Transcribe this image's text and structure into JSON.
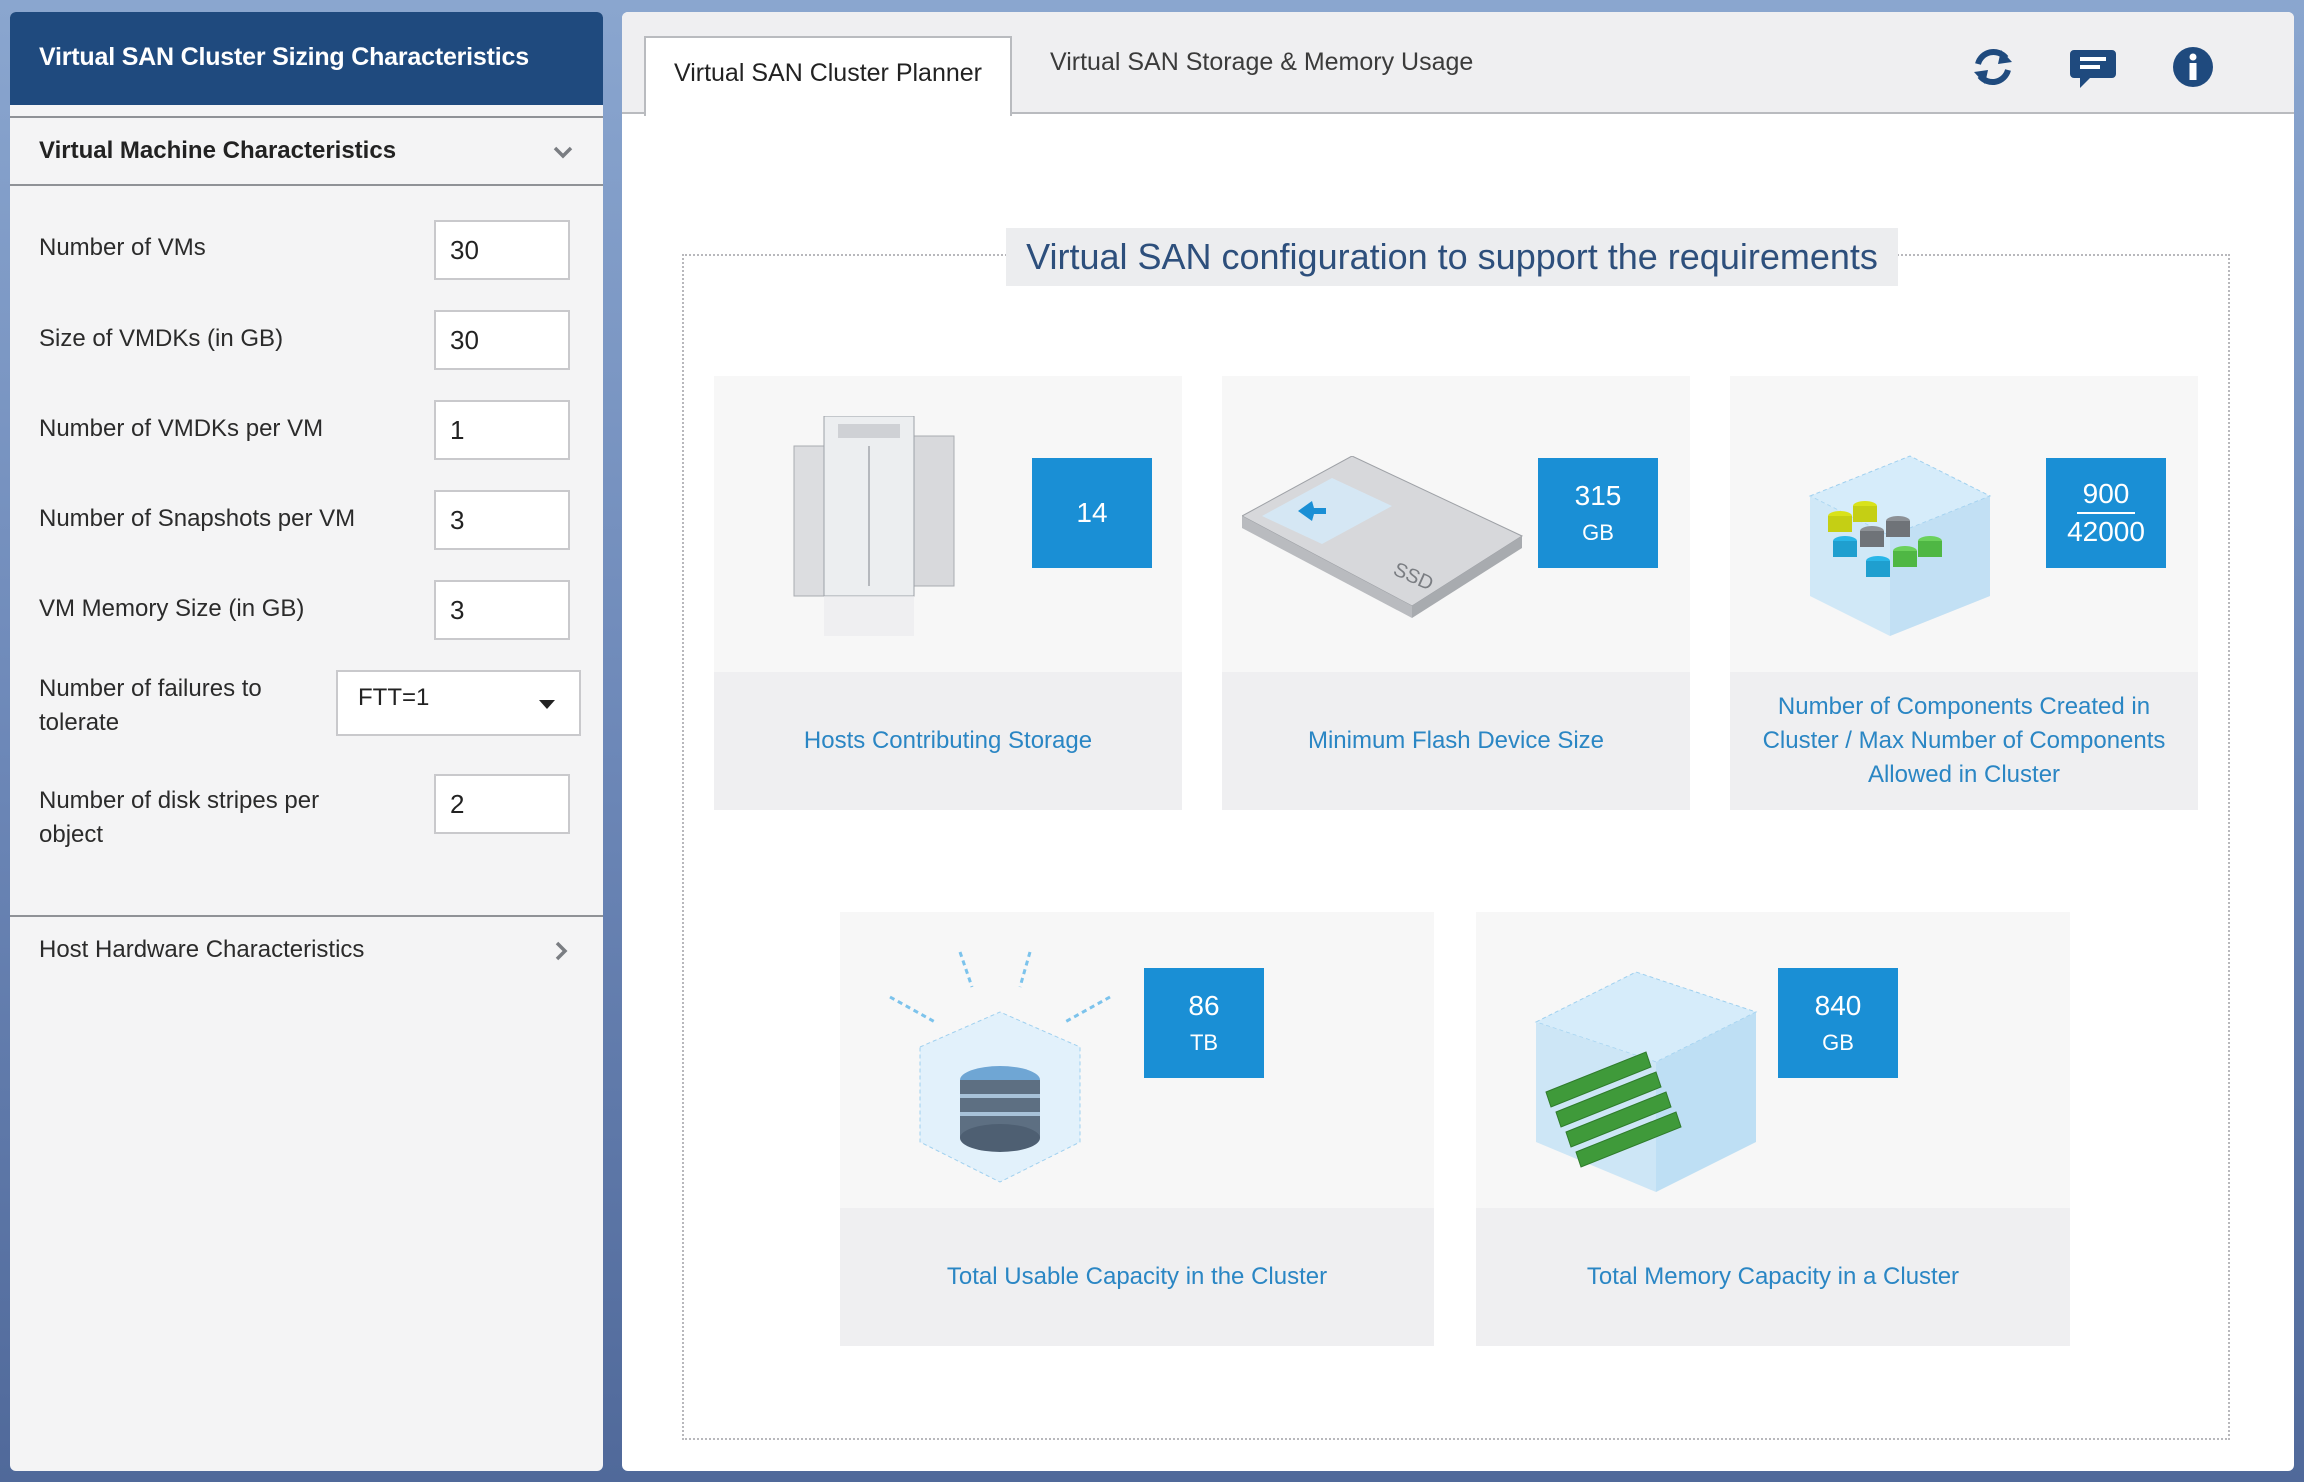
{
  "left_panel": {
    "title": "Virtual SAN Cluster Sizing Characteristics",
    "vm_section": {
      "title": "Virtual Machine Characteristics",
      "fields": [
        {
          "label": "Number of VMs",
          "value": "30"
        },
        {
          "label": "Size of VMDKs (in GB)",
          "value": "30"
        },
        {
          "label": "Number of VMDKs per VM",
          "value": "1"
        },
        {
          "label": "Number of Snapshots per VM",
          "value": "3"
        },
        {
          "label": "VM Memory Size (in GB)",
          "value": "3"
        }
      ],
      "ftt": {
        "label_line1": "Number of failures to",
        "label_line2": "tolerate",
        "value": "FTT=1"
      },
      "stripes": {
        "label_line1": "Number of disk stripes per",
        "label_line2": "object",
        "value": "2"
      }
    },
    "host_section": {
      "title": "Host Hardware Characteristics"
    }
  },
  "right_panel": {
    "tabs": [
      {
        "label": "Virtual SAN Cluster Planner",
        "active": true
      },
      {
        "label": "Virtual SAN Storage & Memory Usage",
        "active": false
      }
    ],
    "toolbar_icons": [
      "refresh-icon",
      "comment-icon",
      "info-icon"
    ],
    "config_title": "Virtual SAN configuration to support the requirements",
    "cards": [
      {
        "value": "14",
        "unit": "",
        "caption": "Hosts Contributing Storage"
      },
      {
        "value": "315",
        "unit": "GB",
        "caption": "Minimum Flash Device Size"
      },
      {
        "value_top": "900",
        "value_bottom": "42000",
        "caption": "Number of Components Created in Cluster / Max Number of Components Allowed in Cluster"
      },
      {
        "value": "86",
        "unit": "TB",
        "caption": "Total Usable Capacity in the Cluster"
      },
      {
        "value": "840",
        "unit": "GB",
        "caption": "Total Memory Capacity in a Cluster"
      }
    ],
    "colors": {
      "accent": "#1a8fd5",
      "header": "#1f4a7e",
      "caption": "#2a86c4"
    }
  }
}
